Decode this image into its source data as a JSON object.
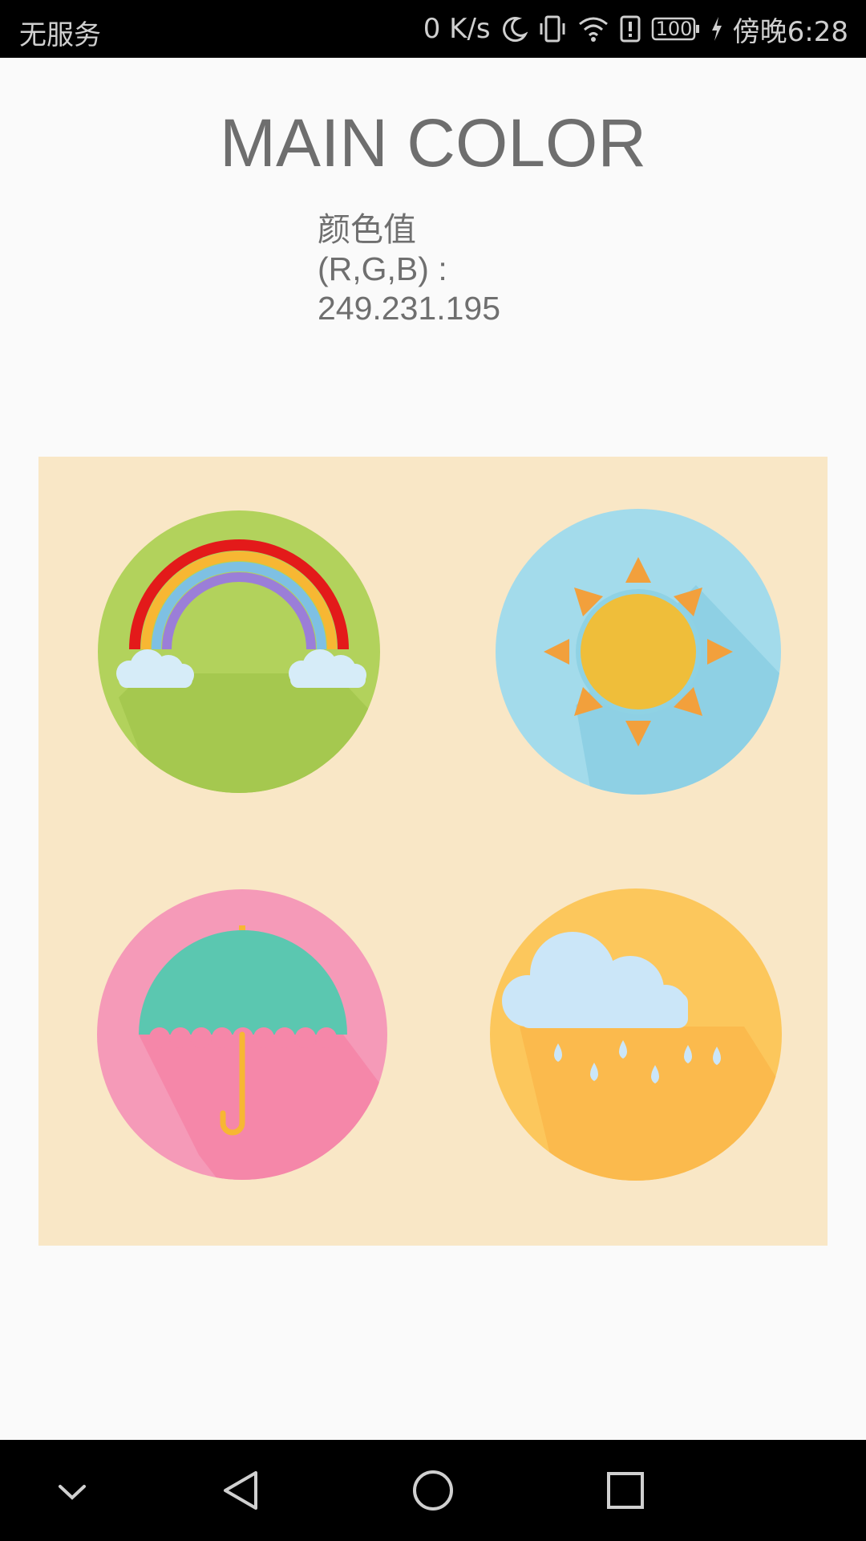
{
  "status_bar": {
    "carrier": "无服务",
    "net_speed": "0 K/s",
    "battery": "100",
    "time": "傍晚6:28"
  },
  "main": {
    "title": "MAIN COLOR",
    "color_label": "颜色值",
    "rgb_label": "(R,G,B) :",
    "rgb_value": "249.231.195"
  },
  "palette_image": {
    "background": "#f9e7c6",
    "tiles": [
      "rainbow",
      "sun",
      "umbrella",
      "rain-cloud"
    ]
  },
  "nav_bar": {
    "icons": [
      "chevron-down-icon",
      "back-icon",
      "home-icon",
      "recents-icon"
    ]
  },
  "colors": {
    "status_bar_bg": "#000000",
    "page_bg": "#fafafa",
    "title_text": "#6e6e6e"
  }
}
